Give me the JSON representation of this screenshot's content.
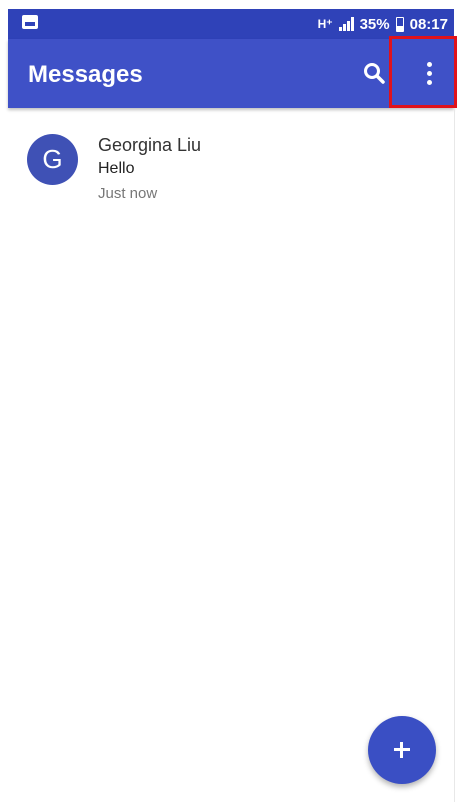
{
  "status_bar": {
    "network_type": "H⁺",
    "battery_percent": "35%",
    "time": "08:17",
    "battery_level": 0.35,
    "icons": [
      "image-notification-icon",
      "signal-icon",
      "battery-icon"
    ]
  },
  "app_bar": {
    "title": "Messages",
    "actions": [
      "search-icon",
      "more-vert-icon"
    ]
  },
  "conversations": [
    {
      "avatar_initial": "G",
      "avatar_color": "#3f51b5",
      "name": "Georgina Liu",
      "snippet": "Hello",
      "time": "Just now"
    }
  ],
  "fab": {
    "icon": "plus-icon"
  },
  "colors": {
    "primary": "#3f51c7",
    "primary_dark": "#2f42b8",
    "highlight": "#e0121b"
  }
}
